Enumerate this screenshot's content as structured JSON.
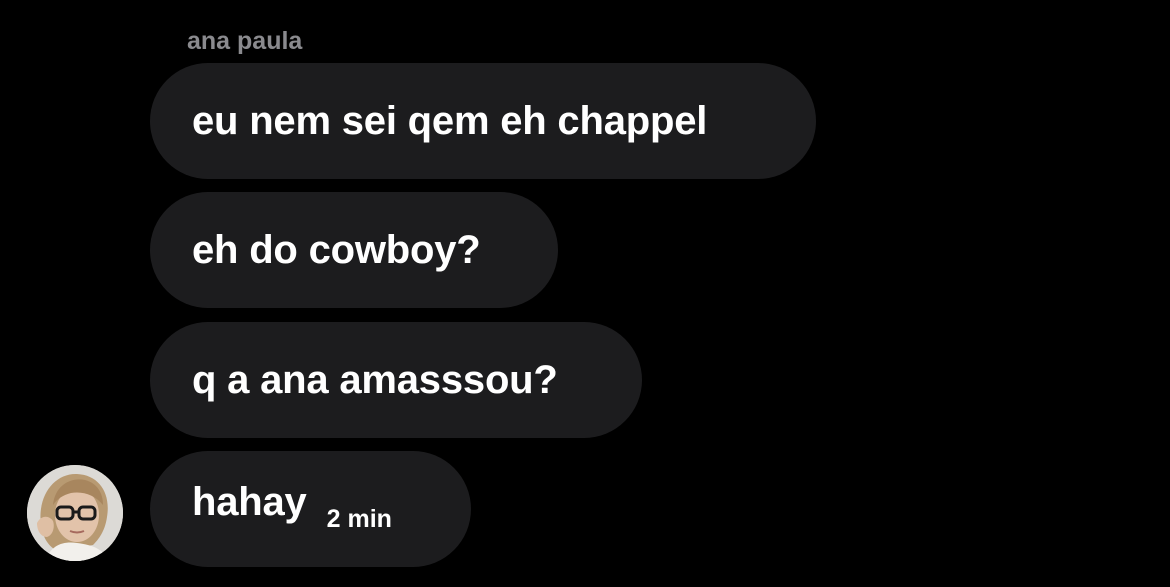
{
  "conversation": {
    "sender_name": "ana paula",
    "messages": [
      {
        "text": "eu nem sei qem eh chappel"
      },
      {
        "text": "eh do cowboy?"
      },
      {
        "text": "q a ana amasssou?"
      },
      {
        "text": "hahay",
        "timestamp": "2 min"
      }
    ],
    "avatar_icon": "user-avatar-photo"
  },
  "colors": {
    "background": "#000000",
    "bubble": "#1c1c1e",
    "sender_name": "#8a8a8e",
    "text": "#ffffff"
  }
}
